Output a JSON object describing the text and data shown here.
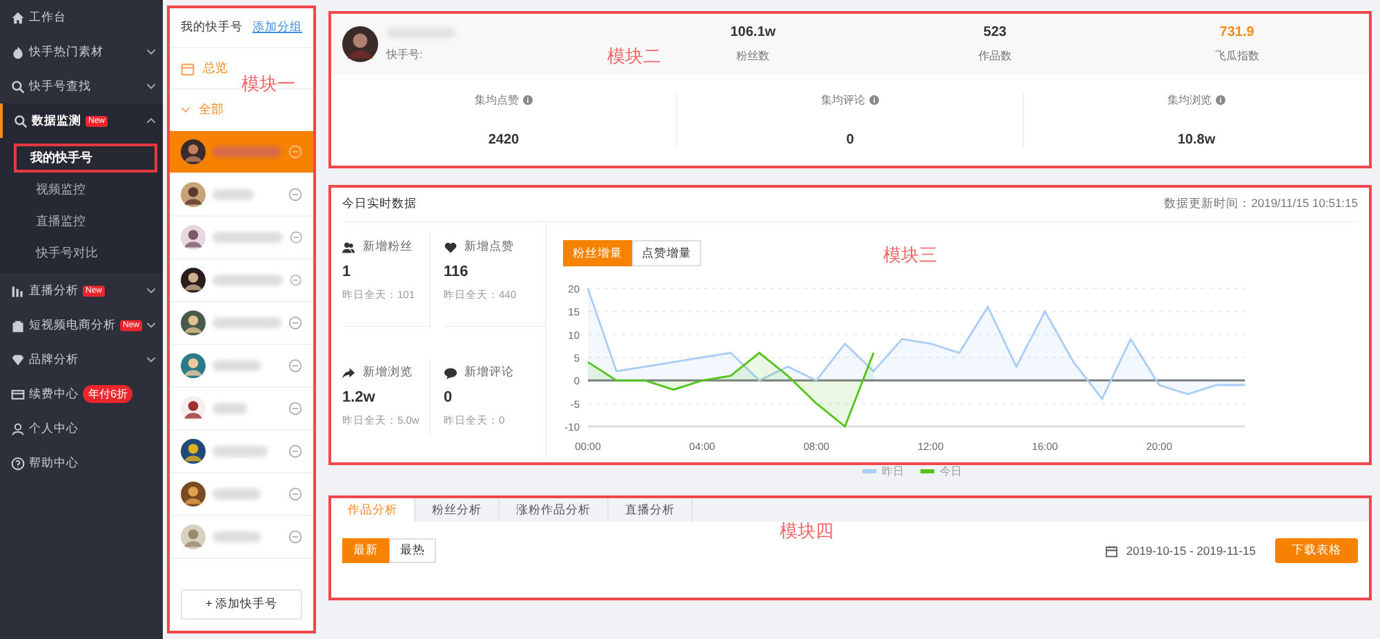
{
  "sidebar": {
    "items": [
      {
        "label": "工作台"
      },
      {
        "label": "快手热门素材",
        "expanded": false
      },
      {
        "label": "快手号查找",
        "expanded": false
      },
      {
        "label": "数据监测",
        "badge": "New",
        "expanded": true,
        "selected": true,
        "children": [
          {
            "label": "我的快手号",
            "selected": true,
            "annotated": true
          },
          {
            "label": "视频监控",
            "selected": false,
            "annotated": false
          },
          {
            "label": "直播监控",
            "selected": false,
            "annotated": false
          },
          {
            "label": "快手号对比",
            "selected": false,
            "annotated": false
          }
        ]
      },
      {
        "label": "直播分析",
        "badge": "New",
        "expanded": false
      },
      {
        "label": "短视频电商分析",
        "badge": "New",
        "expanded": false
      },
      {
        "label": "品牌分析",
        "expanded": false
      },
      {
        "label": "续费中心",
        "badge": "年付6折"
      },
      {
        "label": "个人中心"
      },
      {
        "label": "帮助中心"
      }
    ]
  },
  "accounts_panel": {
    "annotation": "模块一",
    "title": "我的快手号",
    "add_group": "添加分组",
    "overview": "总览",
    "group": {
      "label": "全部",
      "expanded": true
    },
    "accounts": [
      {
        "selected": true
      },
      {
        "selected": false
      },
      {
        "selected": false
      },
      {
        "selected": false
      },
      {
        "selected": false
      },
      {
        "selected": false
      },
      {
        "selected": false
      },
      {
        "selected": false
      },
      {
        "selected": false
      },
      {
        "selected": false
      }
    ],
    "add_button": "+ 添加快手号"
  },
  "profile": {
    "annotation": "模块二",
    "id_label": "快手号:",
    "stats": [
      {
        "value": "106.1w",
        "label": "粉丝数",
        "highlight": false
      },
      {
        "value": "523",
        "label": "作品数",
        "highlight": false
      },
      {
        "value": "731.9",
        "label": "飞瓜指数",
        "highlight": true
      }
    ],
    "averages": [
      {
        "label": "集均点赞",
        "value": "2420"
      },
      {
        "label": "集均评论",
        "value": "0"
      },
      {
        "label": "集均浏览",
        "value": "10.8w"
      }
    ]
  },
  "realtime": {
    "annotation": "模块三",
    "title": "今日实时数据",
    "updated": "数据更新时间：2019/11/15 10:51:15",
    "metrics": [
      {
        "label": "新增粉丝",
        "value": "1",
        "yesterday": "昨日全天：101"
      },
      {
        "label": "新增点赞",
        "value": "116",
        "yesterday": "昨日全天：440"
      },
      {
        "label": "新增浏览",
        "value": "1.2w",
        "yesterday": "昨日全天：5.0w"
      },
      {
        "label": "新增评论",
        "value": "0",
        "yesterday": "昨日全天：0"
      }
    ],
    "toggle": [
      {
        "label": "粉丝增量",
        "selected": true
      },
      {
        "label": "点赞增量",
        "selected": false
      }
    ],
    "chart_data": {
      "type": "area",
      "x": [
        0,
        1,
        2,
        3,
        4,
        5,
        6,
        7,
        8,
        9,
        10,
        11,
        12,
        13,
        14,
        15,
        16,
        17,
        18,
        19,
        20,
        21,
        22,
        23
      ],
      "xlim": [
        0,
        23
      ],
      "ylim": [
        -10,
        20
      ],
      "grid": true,
      "yticks": [
        -10,
        -5,
        0,
        5,
        10,
        15,
        20
      ],
      "xticks": [
        {
          "value": 0,
          "label": "00:00"
        },
        {
          "value": 4,
          "label": "04:00"
        },
        {
          "value": 8,
          "label": "08:00"
        },
        {
          "value": 12,
          "label": "12:00"
        },
        {
          "value": 16,
          "label": "16:00"
        },
        {
          "value": 20,
          "label": "20:00"
        }
      ],
      "series": [
        {
          "name": "昨日",
          "color": "#a9cdf5",
          "values": [
            20,
            2,
            3,
            4,
            5,
            6,
            0,
            3,
            0,
            8,
            2,
            9,
            8,
            6,
            16,
            3,
            15,
            4,
            -4,
            9,
            -1,
            -3,
            -1,
            -1
          ]
        },
        {
          "name": "今日",
          "color": "#52c41a",
          "values": [
            4,
            0,
            0,
            -2,
            0,
            1,
            6,
            1,
            -5,
            -10,
            6,
            null,
            null,
            null,
            null,
            null,
            null,
            null,
            null,
            null,
            null,
            null,
            null,
            null
          ]
        }
      ]
    }
  },
  "analysis": {
    "annotation": "模块四",
    "tabs": [
      {
        "label": "作品分析",
        "selected": true
      },
      {
        "label": "粉丝分析",
        "selected": false
      },
      {
        "label": "涨粉作品分析",
        "selected": false
      },
      {
        "label": "直播分析",
        "selected": false
      }
    ],
    "sort": [
      {
        "label": "最新",
        "selected": true
      },
      {
        "label": "最热",
        "selected": false
      }
    ],
    "date_range": "2019-10-15 - 2019-11-15",
    "download": "下载表格"
  }
}
